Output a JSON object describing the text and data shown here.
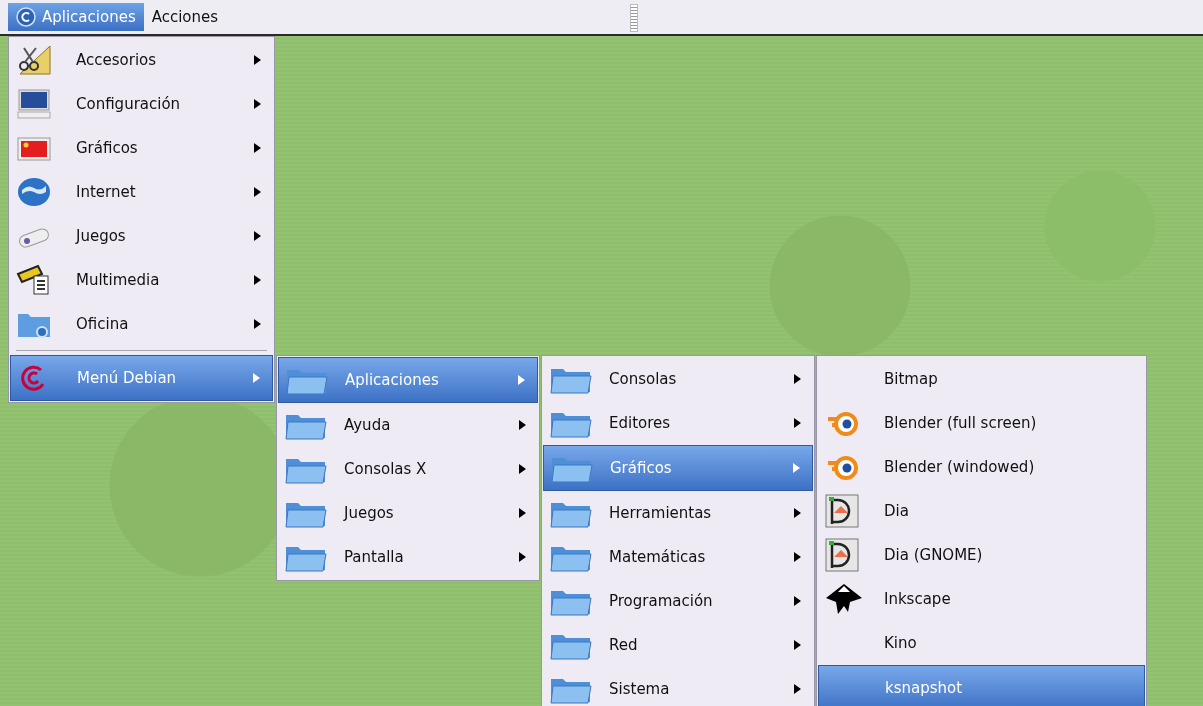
{
  "panel": {
    "items": [
      {
        "label": "Aplicaciones",
        "selected": true
      },
      {
        "label": "Acciones",
        "selected": false
      }
    ]
  },
  "menus": [
    {
      "sections": [
        [
          {
            "label": "Accesorios",
            "selected": false,
            "submenu": true
          },
          {
            "label": "Configuración",
            "selected": false,
            "submenu": true
          },
          {
            "label": "Gráficos",
            "selected": false,
            "submenu": true
          },
          {
            "label": "Internet",
            "selected": false,
            "submenu": true
          },
          {
            "label": "Juegos",
            "selected": false,
            "submenu": true
          },
          {
            "label": "Multimedia",
            "selected": false,
            "submenu": true
          },
          {
            "label": "Oficina",
            "selected": false,
            "submenu": true
          }
        ],
        [
          {
            "label": "Menú Debian",
            "selected": true,
            "submenu": true
          }
        ]
      ]
    },
    {
      "sections": [
        [
          {
            "label": "Aplicaciones",
            "selected": true,
            "submenu": true
          },
          {
            "label": "Ayuda",
            "selected": false,
            "submenu": true
          },
          {
            "label": "Consolas X",
            "selected": false,
            "submenu": true
          },
          {
            "label": "Juegos",
            "selected": false,
            "submenu": true
          },
          {
            "label": "Pantalla",
            "selected": false,
            "submenu": true
          }
        ]
      ]
    },
    {
      "sections": [
        [
          {
            "label": "Consolas",
            "selected": false,
            "submenu": true
          },
          {
            "label": "Editores",
            "selected": false,
            "submenu": true
          },
          {
            "label": "Gráficos",
            "selected": true,
            "submenu": true
          },
          {
            "label": "Herramientas",
            "selected": false,
            "submenu": true
          },
          {
            "label": "Matemáticas",
            "selected": false,
            "submenu": true
          },
          {
            "label": "Programación",
            "selected": false,
            "submenu": true
          },
          {
            "label": "Red",
            "selected": false,
            "submenu": true
          },
          {
            "label": "Sistema",
            "selected": false,
            "submenu": true
          }
        ]
      ]
    },
    {
      "sections": [
        [
          {
            "label": "Bitmap",
            "selected": false
          },
          {
            "label": "Blender (full screen)",
            "selected": false
          },
          {
            "label": "Blender (windowed)",
            "selected": false
          },
          {
            "label": "Dia",
            "selected": false
          },
          {
            "label": "Dia (GNOME)",
            "selected": false
          },
          {
            "label": "Inkscape",
            "selected": false
          },
          {
            "label": "Kino",
            "selected": false
          },
          {
            "label": "ksnapshot",
            "selected": true
          }
        ]
      ]
    }
  ]
}
